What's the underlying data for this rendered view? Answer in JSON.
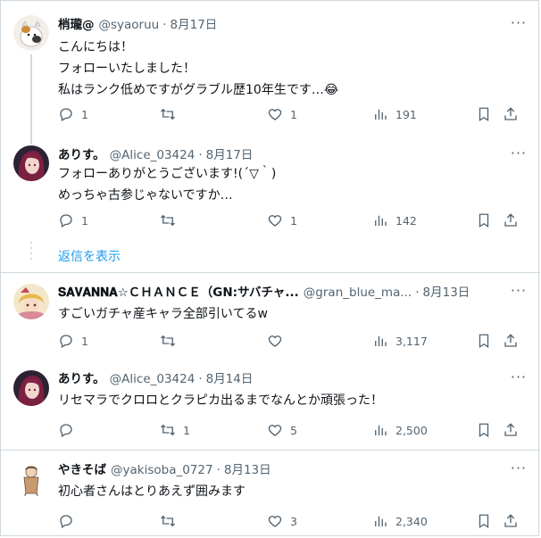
{
  "replies_link": "返信を表示",
  "tweets": [
    {
      "name": "梢瓏@",
      "handle": "@syaoruu",
      "date": "8月17日",
      "lines": [
        "こんにちは！",
        "フォローいたしました！",
        "私はランク低めですがグラブル歴10年生です…😂"
      ],
      "replies": "1",
      "retweets": "",
      "likes": "1",
      "views": "191"
    },
    {
      "name": "ありす。",
      "handle": "@Alice_03424",
      "date": "8月17日",
      "lines": [
        "フォローありがとうございます!(´▽｀)",
        "めっちゃ古参じゃないですか…"
      ],
      "replies": "1",
      "retweets": "",
      "likes": "1",
      "views": "142"
    },
    {
      "name": "𝐒𝐀𝐕𝐀𝐍𝐍𝐀☆ＣＨＡＮＣＥ（GN:サバチャ...",
      "handle": "@gran_blue_ma...",
      "date": "8月13日",
      "lines": [
        "すごいガチャ産キャラ全部引いてるw"
      ],
      "replies": "1",
      "retweets": "",
      "likes": "",
      "views": "3,117"
    },
    {
      "name": "ありす。",
      "handle": "@Alice_03424",
      "date": "8月14日",
      "lines": [
        "リセマラでクロロとクラピカ出るまでなんとか頑張った！"
      ],
      "replies": "",
      "retweets": "1",
      "likes": "5",
      "views": "2,500"
    },
    {
      "name": "やきそば",
      "handle": "@yakisoba_0727",
      "date": "8月13日",
      "lines": [
        "初心者さんはとりあえず囲みます"
      ],
      "replies": "",
      "retweets": "",
      "likes": "3",
      "views": "2,340"
    }
  ]
}
